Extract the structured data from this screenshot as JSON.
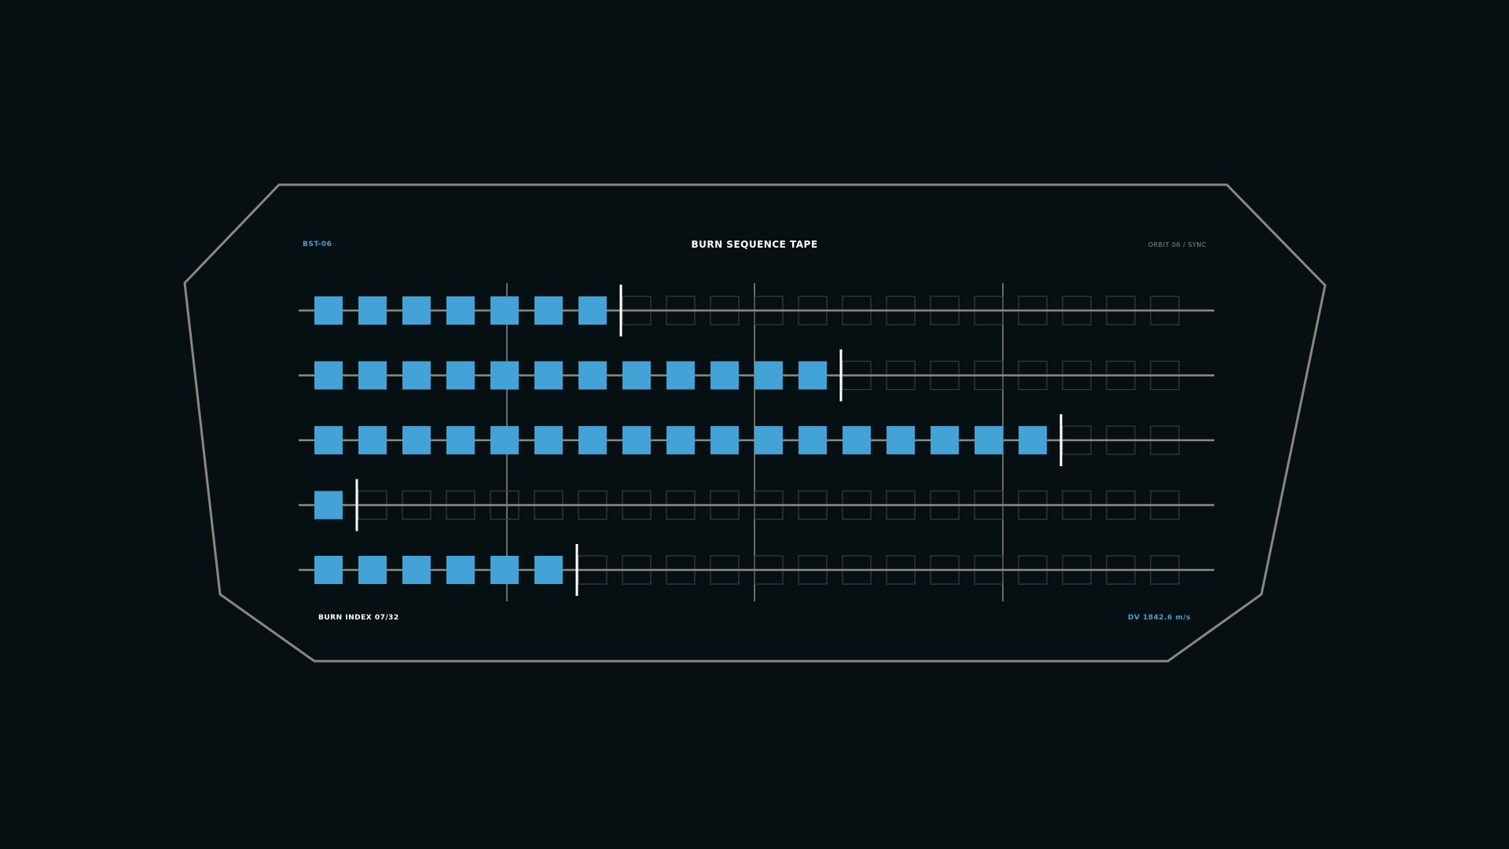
{
  "panel": {
    "id_label": "BST-06",
    "title": "BURN SEQUENCE TAPE",
    "orbit_status": "ORBIT 06 / SYNC",
    "burn_index": "BURN INDEX 07/32",
    "delta_v": "DV 1842.6 m/s"
  },
  "tape": {
    "cells_per_track": 20,
    "tracks": [
      {
        "filled": 7
      },
      {
        "filled": 12
      },
      {
        "filled": 17
      },
      {
        "filled": 1
      },
      {
        "filled": 6
      }
    ]
  },
  "colors": {
    "background": "#060f12",
    "frame": "#8a8780",
    "filled_cell": "#43a2d6",
    "empty_cell_outline": "#3a3e3d",
    "track_line": "#8f8b82",
    "grid_line": "#6e6b66",
    "cursor": "#ffffff",
    "accent_text": "#4a9fd3",
    "title_text": "#ffffff",
    "muted_text": "#8e8e8e"
  }
}
